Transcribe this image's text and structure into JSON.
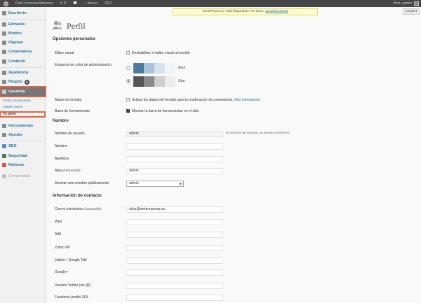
{
  "adminbar": {
    "site_name": "Pack Empresa Baleares",
    "updates_count": "8",
    "new_label": "Nuevo",
    "seo_label": "SEO",
    "greeting": "Hola, admin"
  },
  "sidebar": {
    "items": [
      {
        "label": "Escritorio",
        "icon": "dashboard-icon"
      },
      {
        "label": "Entradas",
        "icon": "posts-icon"
      },
      {
        "label": "Medios",
        "icon": "media-icon"
      },
      {
        "label": "Páginas",
        "icon": "pages-icon"
      },
      {
        "label": "Comentarios",
        "icon": "comments-icon"
      },
      {
        "label": "Contacto",
        "icon": "contact-icon"
      },
      {
        "label": "Apariencia",
        "icon": "appearance-icon"
      },
      {
        "label": "Plugins",
        "icon": "plugins-icon",
        "badge": "8"
      },
      {
        "label": "Usuarios",
        "icon": "users-icon"
      },
      {
        "label": "Herramientas",
        "icon": "tools-icon"
      },
      {
        "label": "Ajustes",
        "icon": "settings-icon"
      },
      {
        "label": "SEO",
        "icon": "seo-icon"
      },
      {
        "label": "Seguridad",
        "icon": "security-icon"
      },
      {
        "label": "Reformo",
        "icon": "reformo-icon"
      },
      {
        "label": "Cerrar menú",
        "icon": "collapse-icon"
      }
    ],
    "users_submenu": [
      "Todos los usuarios",
      "Añadir nuevo",
      "Tu perfil"
    ]
  },
  "notice": {
    "text": "WordPress 3.7 está disponible! Por favor,",
    "link": "actualiza ahora"
  },
  "help_label": "Ayuda",
  "page_title": "Perfil",
  "personal": {
    "title": "Opciones personales",
    "visual_editor_label": "Editor visual",
    "visual_editor_option": "Deshabilitar el editor visual al escribir",
    "color_scheme_label": "Esquema de color de administración",
    "schemes": [
      {
        "name": "Azul",
        "colors": [
          "#4d7ba0",
          "#a9c4da",
          "#d5e3ee",
          "#eef3f8"
        ],
        "selected": false
      },
      {
        "name": "Gris",
        "colors": [
          "#555555",
          "#8a8a8a",
          "#cfcfcf",
          "#ececec"
        ],
        "selected": true
      }
    ],
    "keyboard_label": "Atajos de teclado",
    "keyboard_option": "Activar los atajos del teclado para la moderación de comentarios.",
    "keyboard_link": "Más información",
    "toolbar_label": "Barra de herramientas",
    "toolbar_option": "Mostrar la barra de herramientas en el sitio"
  },
  "name": {
    "title": "Nombre",
    "username_label": "Nombre de usuario",
    "username_value": "admin",
    "username_hint": "El nombre de usuario no puede cambiarse.",
    "first_label": "Nombre",
    "last_label": "Apellidos",
    "nickname_label": "Alias",
    "nickname_required": "(requerido)",
    "nickname_value": "admin",
    "display_label": "Mostrar este nombre públicamente",
    "display_value": "admin"
  },
  "contact": {
    "title": "Información de contacto",
    "email_label": "Correo electrónico",
    "email_required": "(requerido)",
    "email_value": "alejo@webempresa.eu",
    "web_label": "Web",
    "aim_label": "AIM",
    "yahoo_label": "Yahoo IM",
    "jabber_label": "Jabber / Google Talk",
    "google_label": "Google+",
    "twitter_label": "Usuario Twitter (sin @)",
    "facebook_label": "Facebook profile URL"
  }
}
